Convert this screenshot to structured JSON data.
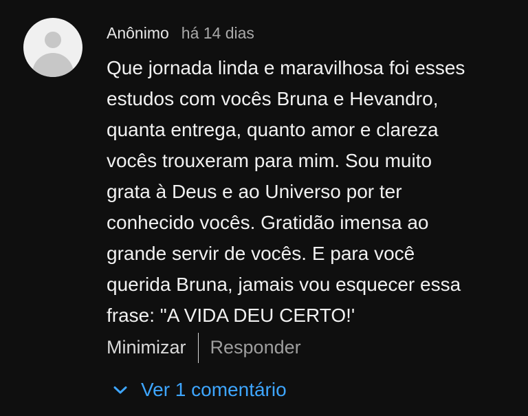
{
  "comment": {
    "author": "Anônimo",
    "time": "há 14 dias",
    "text": "Que jornada linda e maravilhosa foi esses\nestudos com vocês Bruna e Hevandro,\nquanta entrega, quanto amor e clareza\nvocês trouxeram para mim. Sou muito\ngrata à Deus e ao Universo por ter\nconhecido vocês. Gratidão imensa ao\ngrande servir de vocês. E para você\nquerida Bruna, jamais vou esquecer essa\nfrase: \"A VIDA DEU CERTO!'"
  },
  "actions": {
    "minimize_label": "Minimizar",
    "reply_label": "Responder"
  },
  "replies": {
    "label": "Ver 1 comentário",
    "icon": "chevron-down-icon",
    "color": "#3ea6ff"
  },
  "colors": {
    "background": "#0f0f0f",
    "text": "#f1f1f1",
    "muted": "#aaaaaa"
  }
}
